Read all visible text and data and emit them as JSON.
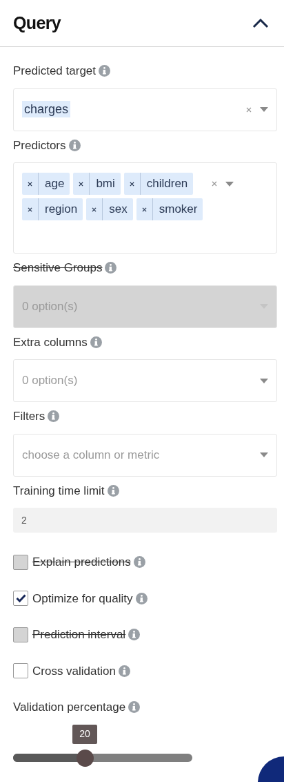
{
  "header": {
    "title": "Query",
    "expanded": true
  },
  "fields": [
    {
      "kind": "single",
      "label": "Predicted target",
      "disabled": false,
      "tags": [
        "charges"
      ]
    },
    {
      "kind": "multi",
      "label": "Predictors",
      "disabled": false,
      "tags": [
        "age",
        "bmi",
        "children",
        "region",
        "sex",
        "smoker"
      ]
    },
    {
      "kind": "dropdown",
      "label": "Sensitive Groups",
      "disabled": true,
      "placeholder": "0 option(s)"
    },
    {
      "kind": "dropdown",
      "label": "Extra columns",
      "disabled": false,
      "placeholder": "0 option(s)"
    },
    {
      "kind": "dropdown",
      "label": "Filters",
      "disabled": false,
      "placeholder": "choose a column or metric"
    },
    {
      "kind": "number",
      "label": "Training time limit",
      "disabled": false,
      "value": "2"
    }
  ],
  "checkboxes": [
    {
      "label": "Explain predictions",
      "checked": false,
      "disabled": true
    },
    {
      "label": "Optimize for quality",
      "checked": true,
      "disabled": false
    },
    {
      "label": "Prediction interval",
      "checked": false,
      "disabled": true
    },
    {
      "label": "Cross validation",
      "checked": false,
      "disabled": false
    }
  ],
  "slider": {
    "label": "Validation percentage",
    "reading": "20",
    "level": 0.4
  }
}
